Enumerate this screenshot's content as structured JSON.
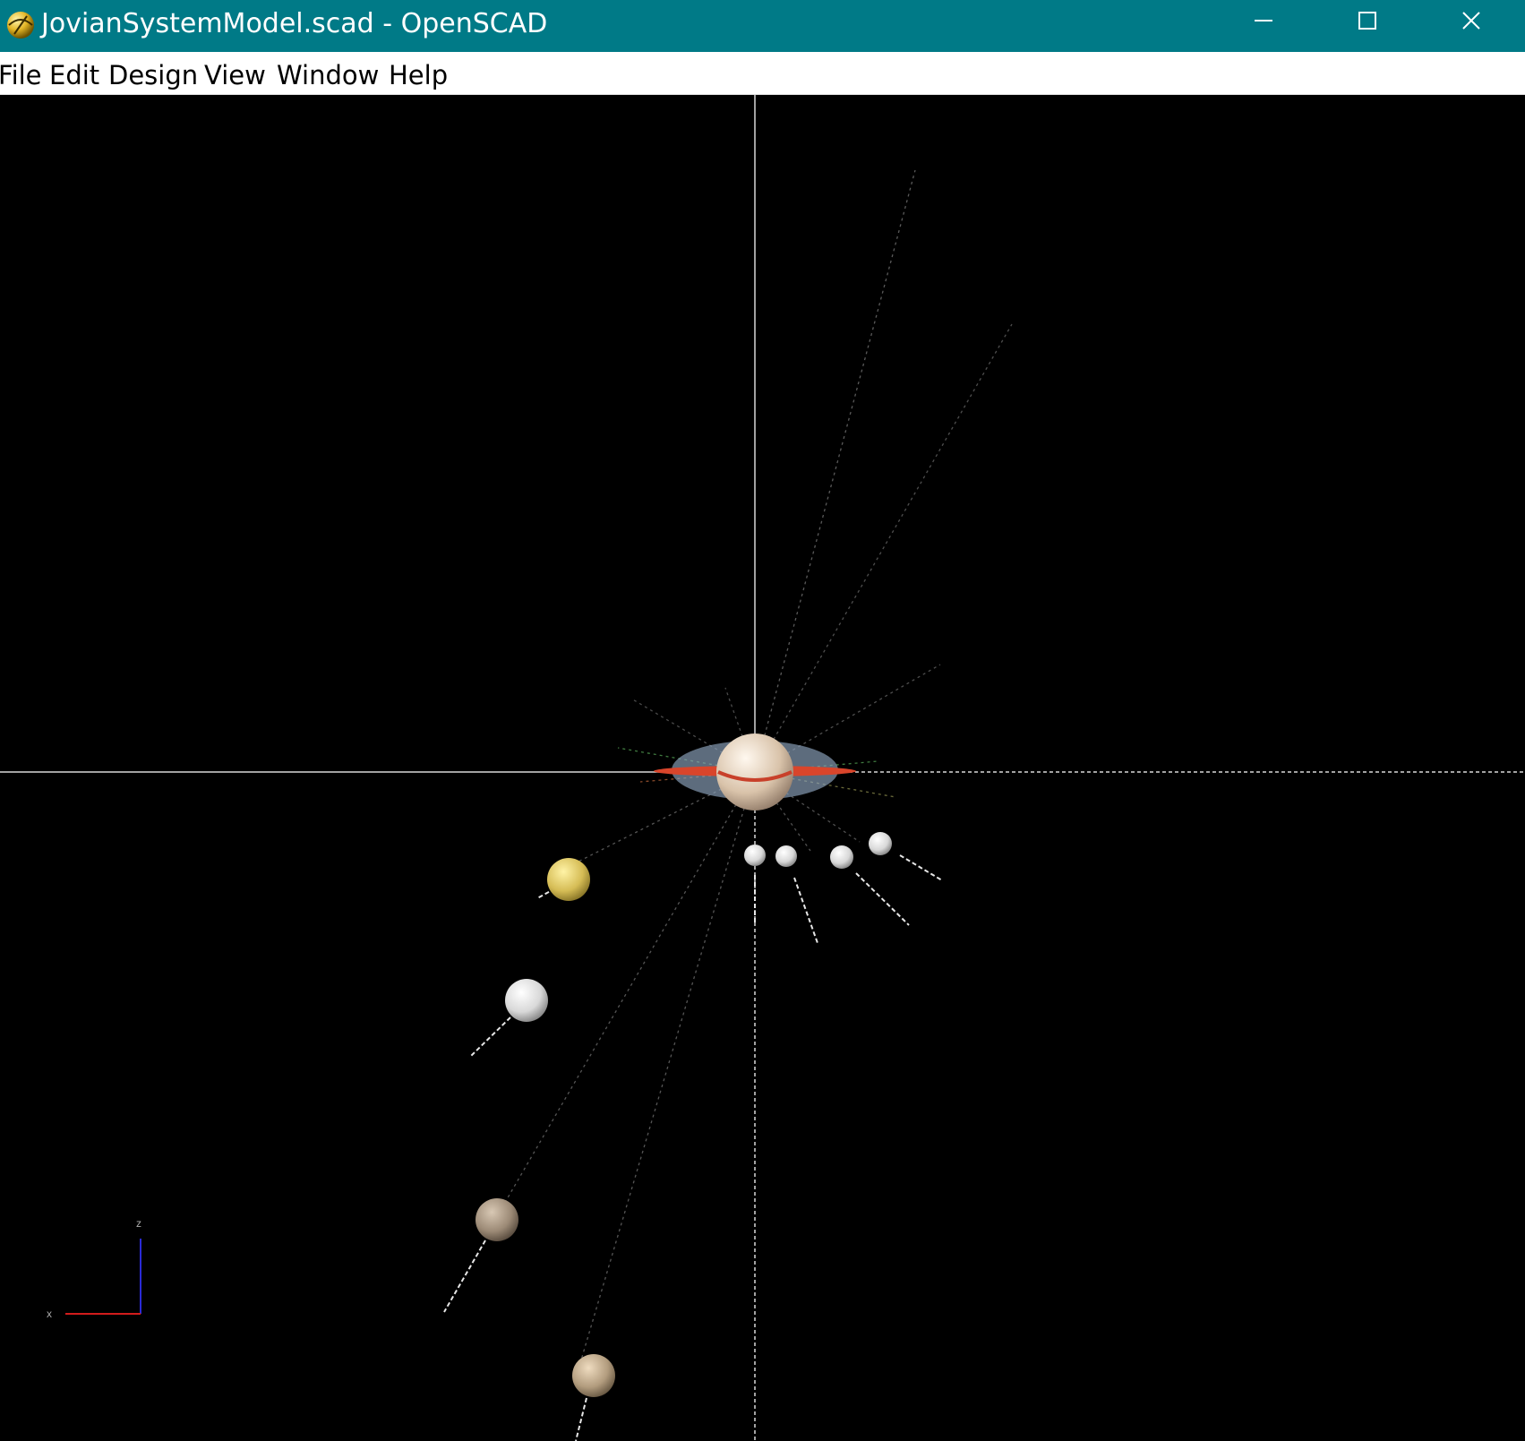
{
  "window": {
    "title": "JovianSystemModel.scad - OpenSCAD",
    "titlebar_color": "#007a87",
    "controls": {
      "minimize_icon": "minimize-icon",
      "maximize_icon": "maximize-icon",
      "close_icon": "close-icon"
    }
  },
  "menu": {
    "items": [
      {
        "label": "File"
      },
      {
        "label": "Edit"
      },
      {
        "label": "Design"
      },
      {
        "label": "View"
      },
      {
        "label": "Window"
      },
      {
        "label": "Help"
      }
    ]
  },
  "viewport": {
    "background": "#000000",
    "axes_indicator": {
      "z_label": "z",
      "x_label": "x",
      "z_color": "#2a2ad6",
      "x_color": "#d11c1c"
    },
    "colors": {
      "planet_body": "#e8d6c3",
      "ring_outer": "#8fa6c0",
      "ring_inner": "#d9452b",
      "moon_gold": "#d9c560",
      "moon_white": "#e6e6e6",
      "moon_tan": "#a89784"
    }
  }
}
